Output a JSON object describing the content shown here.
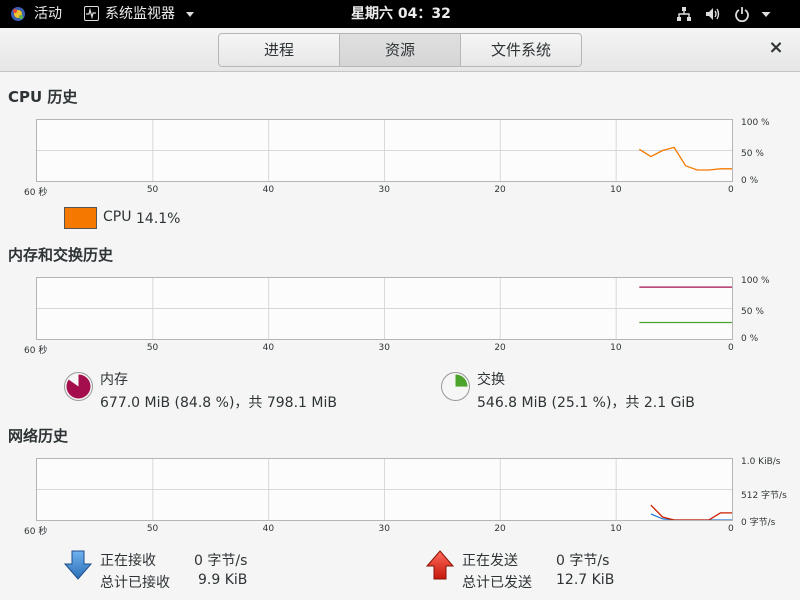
{
  "topbar": {
    "activities": "活动",
    "app_menu": "系统监视器",
    "clock": "星期六 04：32",
    "icons": [
      "network-icon",
      "volume-icon",
      "power-icon",
      "chevron-down-icon"
    ]
  },
  "header": {
    "tabs": [
      {
        "label": "进程",
        "active": false
      },
      {
        "label": "资源",
        "active": true
      },
      {
        "label": "文件系统",
        "active": false
      }
    ],
    "close_label": "×"
  },
  "cpu": {
    "title": "CPU 历史",
    "y_labels": [
      "100 %",
      "50 %",
      "0 %"
    ],
    "x_labels": [
      "60 秒",
      "50",
      "40",
      "30",
      "20",
      "10",
      "0"
    ],
    "legend_label": "CPU",
    "legend_value": "14.1%",
    "color": "#f57900"
  },
  "memory": {
    "title": "内存和交换历史",
    "y_labels": [
      "100 %",
      "50 %",
      "0 %"
    ],
    "x_labels": [
      "60 秒",
      "50",
      "40",
      "30",
      "20",
      "10",
      "0"
    ],
    "mem_label": "内存",
    "mem_value": "677.0 MiB (84.8 %)，共 798.1 MiB",
    "mem_color": "#a40e4c",
    "mem_fraction": 0.848,
    "swap_label": "交换",
    "swap_value": "546.8 MiB (25.1 %)，共 2.1 GiB",
    "swap_color": "#4ca32a",
    "swap_fraction": 0.251
  },
  "network": {
    "title": "网络历史",
    "y_labels": [
      "1.0 KiB/s",
      "512 字节/s",
      "0 字节/s"
    ],
    "x_labels": [
      "60 秒",
      "50",
      "40",
      "30",
      "20",
      "10",
      "0"
    ],
    "recv_label": "正在接收",
    "recv_value": "0 字节/s",
    "recv_total_label": "总计已接收",
    "recv_total_value": "9.9 KiB",
    "send_label": "正在发送",
    "send_value": "0 字节/s",
    "send_total_label": "总计已发送",
    "send_total_value": "12.7 KiB",
    "recv_color": "#2a7fd4",
    "send_color": "#cc1f00"
  },
  "chart_data": [
    {
      "type": "line",
      "xlim": [
        60,
        0
      ],
      "ylim": [
        0,
        100
      ],
      "x": [
        8,
        7,
        6,
        5,
        4,
        3,
        2,
        1,
        0
      ],
      "series": [
        {
          "values": [
            52,
            40,
            50,
            55,
            25,
            18,
            18,
            20,
            20
          ]
        }
      ]
    },
    {
      "type": "line",
      "xlim": [
        60,
        0
      ],
      "ylim": [
        0,
        100
      ],
      "x": [
        8,
        0
      ],
      "series": [
        {
          "name": "内存",
          "values": [
            85,
            85
          ]
        },
        {
          "name": "交换",
          "values": [
            27,
            27
          ]
        }
      ]
    },
    {
      "type": "line",
      "xlim": [
        60,
        0
      ],
      "ylim": [
        0,
        1024
      ],
      "x": [
        7,
        6,
        5,
        4,
        3,
        2,
        1,
        0
      ],
      "series": [
        {
          "name": "正在接收",
          "values": [
            100,
            20,
            0,
            0,
            0,
            0,
            0,
            0
          ]
        },
        {
          "name": "正在发送",
          "values": [
            250,
            50,
            0,
            0,
            0,
            0,
            120,
            120
          ]
        }
      ]
    }
  ]
}
